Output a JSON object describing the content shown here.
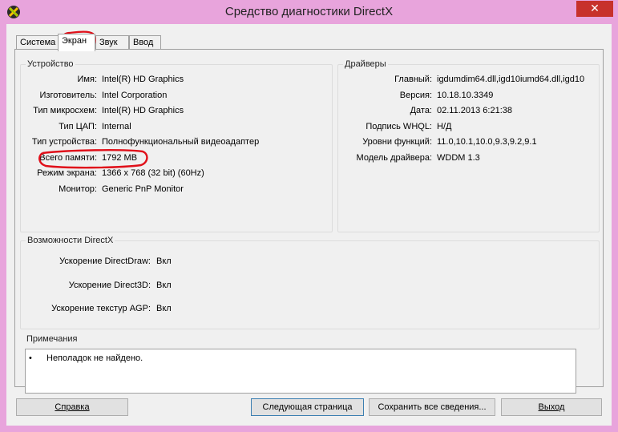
{
  "window": {
    "title": "Средство диагностики DirectX",
    "close_glyph": "✕"
  },
  "tabs": [
    {
      "label": "Система"
    },
    {
      "label": "Экран"
    },
    {
      "label": "Звук"
    },
    {
      "label": "Ввод"
    }
  ],
  "device": {
    "title": "Устройство",
    "rows": [
      {
        "label": "Имя:",
        "value": "Intel(R) HD Graphics"
      },
      {
        "label": "Изготовитель:",
        "value": "Intel Corporation"
      },
      {
        "label": "Тип микросхем:",
        "value": "Intel(R) HD Graphics"
      },
      {
        "label": "Тип ЦАП:",
        "value": "Internal"
      },
      {
        "label": "Тип устройства:",
        "value": "Полнофункциональный видеоадаптер"
      },
      {
        "label": "Всего памяти:",
        "value": "1792 MB"
      },
      {
        "label": "Режим экрана:",
        "value": "1366 x 768 (32 bit) (60Hz)"
      },
      {
        "label": "Монитор:",
        "value": "Generic PnP Monitor"
      }
    ]
  },
  "drivers": {
    "title": "Драйверы",
    "rows": [
      {
        "label": "Главный:",
        "value": "igdumdim64.dll,igd10iumd64.dll,igd10"
      },
      {
        "label": "Версия:",
        "value": "10.18.10.3349"
      },
      {
        "label": "Дата:",
        "value": "02.11.2013 6:21:38"
      },
      {
        "label": "Подпись WHQL:",
        "value": "Н/Д"
      },
      {
        "label": "Уровни функций:",
        "value": "11.0,10.1,10.0,9.3,9.2,9.1"
      },
      {
        "label": "Модель драйвера:",
        "value": "WDDM 1.3"
      }
    ]
  },
  "features": {
    "title": "Возможности DirectX",
    "rows": [
      {
        "label": "Ускорение DirectDraw:",
        "value": "Вкл"
      },
      {
        "label": "Ускорение Direct3D:",
        "value": "Вкл"
      },
      {
        "label": "Ускорение текстур AGP:",
        "value": "Вкл"
      }
    ]
  },
  "notes": {
    "title": "Примечания",
    "bullet": "•",
    "items": [
      "Неполадок не найдено."
    ]
  },
  "buttons": {
    "help": "Справка",
    "next_page": "Следующая страница",
    "save_all": "Сохранить все сведения...",
    "exit": "Выход"
  },
  "colors": {
    "frame": "#e8a4dc",
    "close_button": "#c7312b",
    "annotation": "#e0101a"
  }
}
